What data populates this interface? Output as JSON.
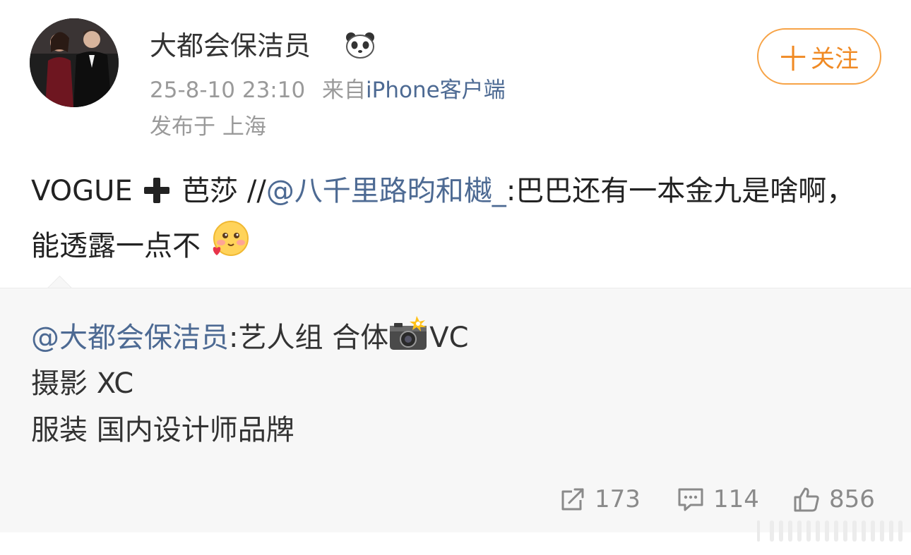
{
  "post": {
    "username": "大都会保洁员",
    "badge_icon": "panda-icon",
    "timestamp": "25-8-10 23:10",
    "source_prefix": "来自",
    "source_client": "iPhone客户端",
    "location": "发布于 上海",
    "follow_label": "关注",
    "follow_plus": "十",
    "text_part1": "VOGUE",
    "plus_icon": "heavy-plus-icon",
    "text_part2": " 芭莎 //",
    "mention": "@八千里路昀和樾_",
    "text_part3": ":巴巴还有一本金九是啥啊，能透露一点不",
    "emoji_icon": "blush-heart-emoji-icon"
  },
  "repost": {
    "mention": "@大都会保洁员",
    "line1_text": ":艺人组 合体",
    "camera_icon": "camera-flash-icon",
    "line1_suffix": "VC",
    "line2": "摄影 XC",
    "line3": "服装 国内设计师品牌"
  },
  "actions": {
    "repost_count": "173",
    "comment_count": "114",
    "like_count": "856"
  },
  "colors": {
    "accent_orange": "#f08a24",
    "link_blue": "#4d6a93",
    "meta_gray": "#9a9a9a",
    "repost_bg": "#f7f7f7"
  }
}
